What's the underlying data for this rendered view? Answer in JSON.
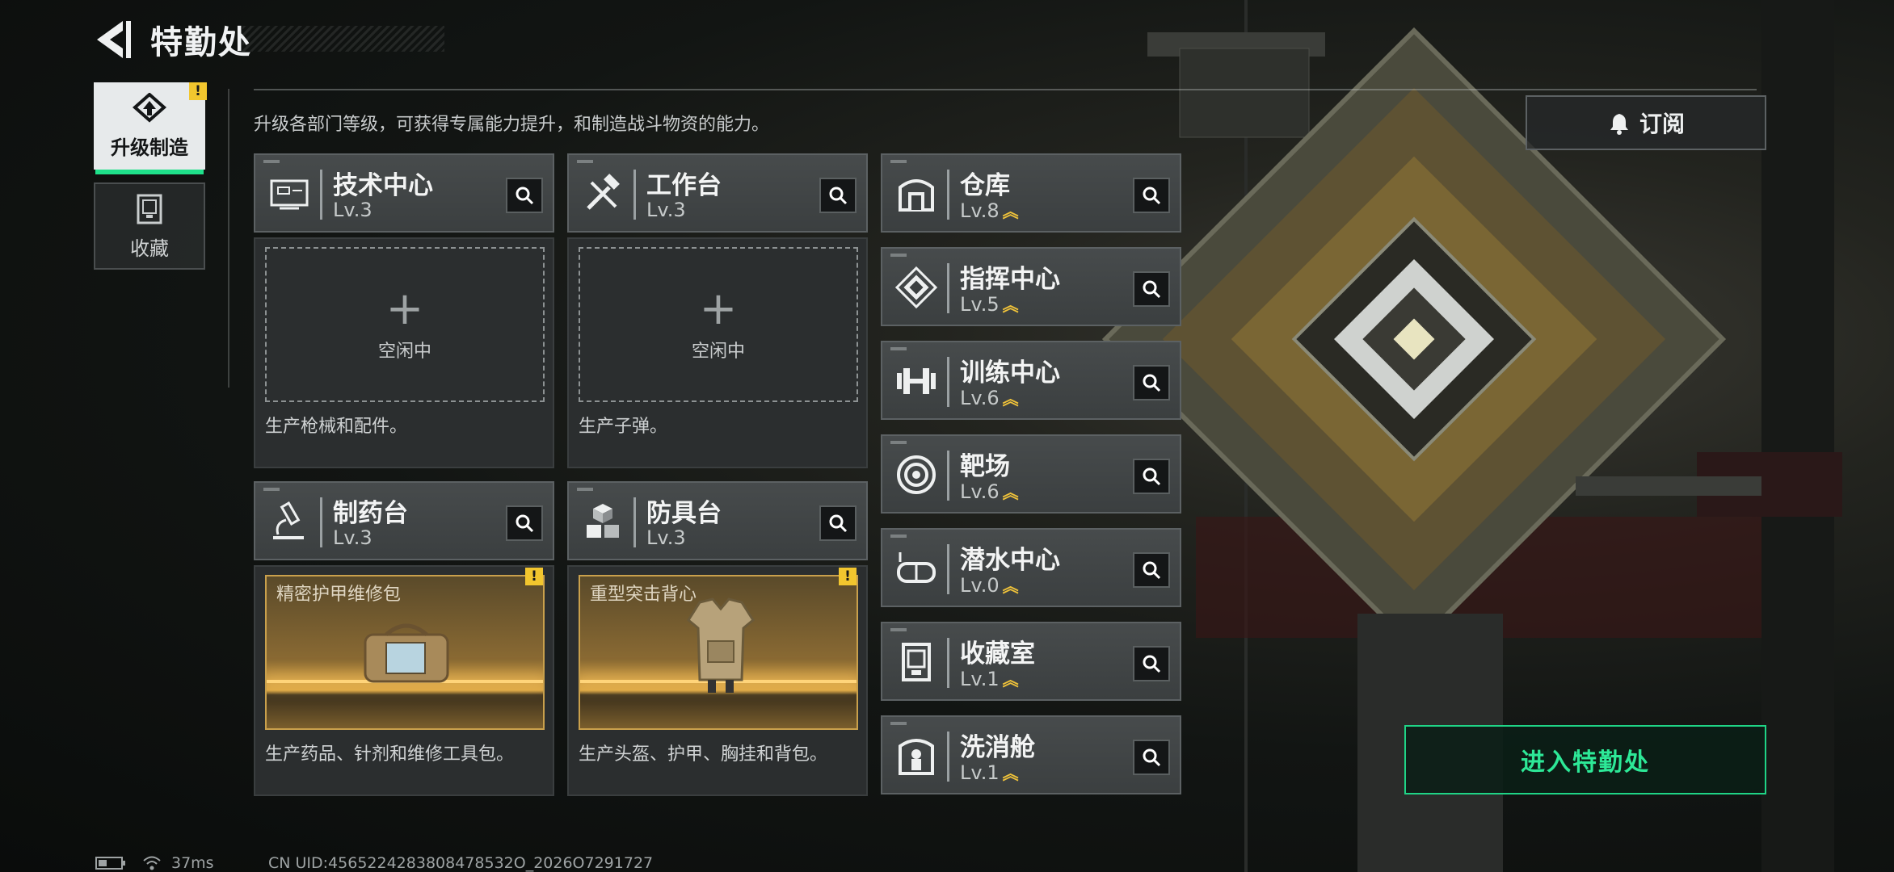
{
  "header": {
    "title": "特勤处"
  },
  "side_tabs": [
    {
      "label": "升级制造",
      "active": true,
      "icon": "upgrade-icon",
      "warning": "!"
    },
    {
      "label": "收藏",
      "active": false,
      "icon": "collection-icon"
    }
  ],
  "description": "升级各部门等级，可获得专属能力提升，和制造战斗物资的能力。",
  "production_cards": [
    {
      "name": "技术中心",
      "level": "Lv.3",
      "icon": "circuit-board-icon",
      "slot": {
        "state": "idle",
        "text": "空闲中"
      },
      "desc": "生产枪械和配件。"
    },
    {
      "name": "工作台",
      "level": "Lv.3",
      "icon": "tools-icon",
      "slot": {
        "state": "idle",
        "text": "空闲中"
      },
      "desc": "生产子弹。"
    },
    {
      "name": "制药台",
      "level": "Lv.3",
      "icon": "microscope-icon",
      "slot": {
        "state": "producing",
        "text": "精密护甲维修包",
        "warning": "!"
      },
      "desc": "生产药品、针剂和维修工具包。"
    },
    {
      "name": "防具台",
      "level": "Lv.3",
      "icon": "boxes-icon",
      "slot": {
        "state": "producing",
        "text": "重型突击背心",
        "warning": "!"
      },
      "desc": "生产头盔、护甲、胸挂和背包。"
    }
  ],
  "facilities": [
    {
      "name": "仓库",
      "level": "Lv.8",
      "icon": "warehouse-icon"
    },
    {
      "name": "指挥中心",
      "level": "Lv.5",
      "icon": "chip-icon"
    },
    {
      "name": "训练中心",
      "level": "Lv.6",
      "icon": "dumbbell-icon"
    },
    {
      "name": "靶场",
      "level": "Lv.6",
      "icon": "target-icon"
    },
    {
      "name": "潜水中心",
      "level": "Lv.0",
      "icon": "diving-mask-icon"
    },
    {
      "name": "收藏室",
      "level": "Lv.1",
      "icon": "display-case-icon"
    },
    {
      "name": "洗消舱",
      "level": "Lv.1",
      "icon": "decon-chamber-icon"
    }
  ],
  "subscribe": {
    "label": "订阅",
    "icon": "bell-icon"
  },
  "enter_button": {
    "label": "进入特勤处"
  },
  "status_bar": {
    "ping": "37ms",
    "uid": "CN UID:4565224283808478532O_2026O7291727"
  },
  "colors": {
    "accent_green": "#1fd486",
    "warning_yellow": "#f2c62e",
    "upgrade_chevron": "#f0c33a"
  }
}
